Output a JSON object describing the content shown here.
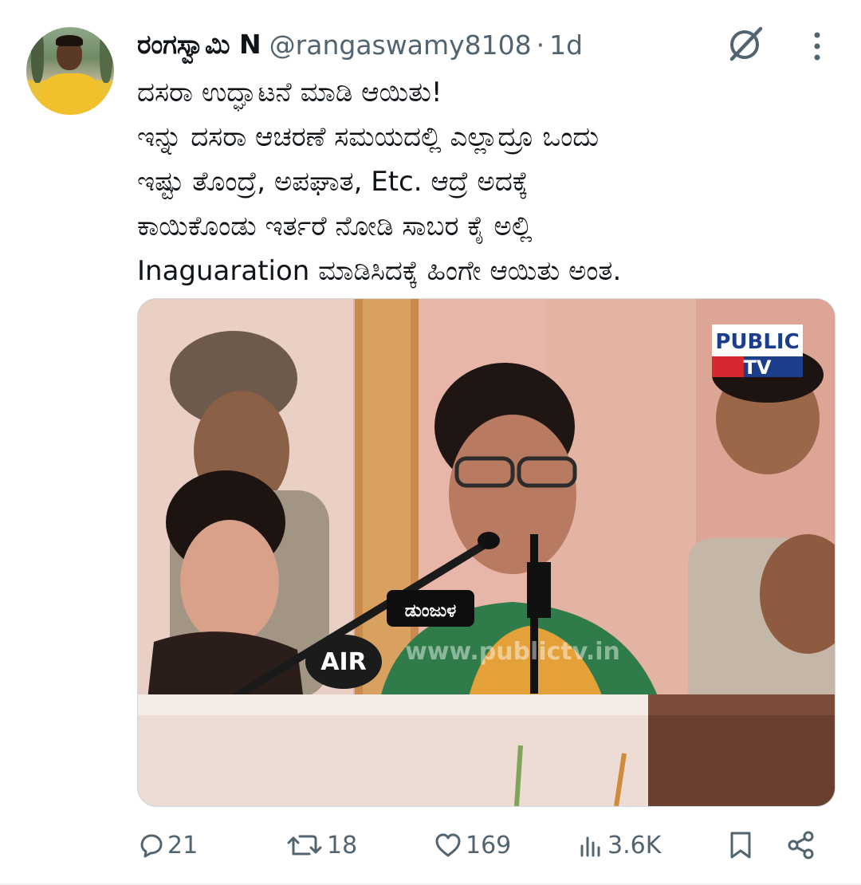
{
  "author": {
    "display_name": "ರಂಗಸ್ವಾಮಿ N",
    "handle": "@rangaswamy8108",
    "separator": "·",
    "time": "1d"
  },
  "tweet": {
    "lines": [
      "ದಸರಾ ಉದ್ಘಾಟನೆ ಮಾಡಿ ಆಯಿತು!",
      "ಇನ್ನು ದಸರಾ ಆಚರಣೆ ಸಮಯದಲ್ಲಿ ಎಲ್ಲಾದ್ರೂ ಒಂದು",
      "ಇಷ್ಟು ತೊಂದ್ರೆ, ಅಪಘಾತ, Etc. ಆದ್ರೆ ಅದಕ್ಕೆ",
      "ಕಾಯಿಕೊಂಡು ಇರ್ತರೆ  ನೋಡಿ ಸಾಬರ ಕೈ ಅಲ್ಲಿ",
      "Inaguaration ಮಾಡಿಸಿದಕ್ಕೆ ಹಿಂಗೇ ಆಯಿತು ಅಂತ."
    ]
  },
  "media": {
    "logo_top": "PUBLIC",
    "logo_bottom": "TV",
    "watermark": "www.publictv.in",
    "mic_air": "AIR",
    "mic_badge": "ಡುಂಜುಳ"
  },
  "actions": {
    "replies": "21",
    "retweets": "18",
    "likes": "169",
    "views": "3.6K"
  },
  "colors": {
    "text_primary": "#0f1419",
    "text_secondary": "#536471",
    "border": "#cfd9de"
  },
  "icons": [
    "grok-icon",
    "more-icon",
    "reply-icon",
    "retweet-icon",
    "like-icon",
    "views-icon",
    "bookmark-icon",
    "share-icon"
  ]
}
